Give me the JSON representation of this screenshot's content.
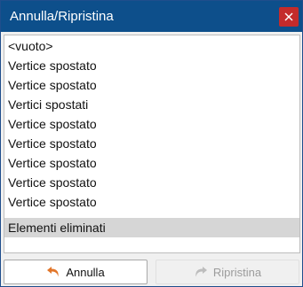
{
  "window": {
    "title": "Annulla/Ripristina"
  },
  "history": {
    "items": [
      {
        "label": "<vuoto>",
        "selected": false
      },
      {
        "label": "Vertice spostato",
        "selected": false
      },
      {
        "label": "Vertice spostato",
        "selected": false
      },
      {
        "label": "Vertici spostati",
        "selected": false
      },
      {
        "label": "Vertice spostato",
        "selected": false
      },
      {
        "label": "Vertice spostato",
        "selected": false
      },
      {
        "label": "Vertice spostato",
        "selected": false
      },
      {
        "label": "Vertice spostato",
        "selected": false
      },
      {
        "label": "Vertice spostato",
        "selected": false
      },
      {
        "label": "Elementi eliminati",
        "selected": true
      }
    ]
  },
  "buttons": {
    "undo_label": "Annulla",
    "undo_icon": "undo-arrow-icon",
    "redo_label": "Ripristina",
    "redo_icon": "redo-arrow-icon",
    "redo_enabled": false
  },
  "colors": {
    "titlebar": "#0d4f8b",
    "close": "#c42b2b",
    "selected_row": "#d6d6d6",
    "undo_icon": "#e2762a",
    "redo_icon_disabled": "#bdbdbd"
  }
}
